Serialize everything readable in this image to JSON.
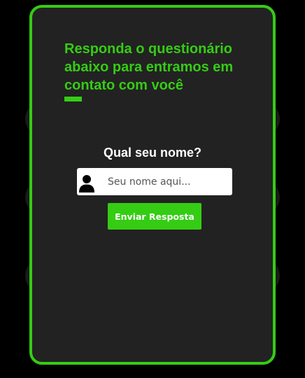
{
  "form": {
    "heading": "Responda o questionário abaixo para entramos em contato com você",
    "question": "Qual seu nome?",
    "name_placeholder": "Seu nome aqui...",
    "name_value": "",
    "submit_label": "Enviar Resposta"
  },
  "icons": {
    "name_field_icon": "user-icon"
  },
  "colors": {
    "accent": "#35cc14",
    "card_background": "#222222",
    "page_background": "#000000",
    "question_text": "#ffffff",
    "input_background": "#ffffff"
  }
}
